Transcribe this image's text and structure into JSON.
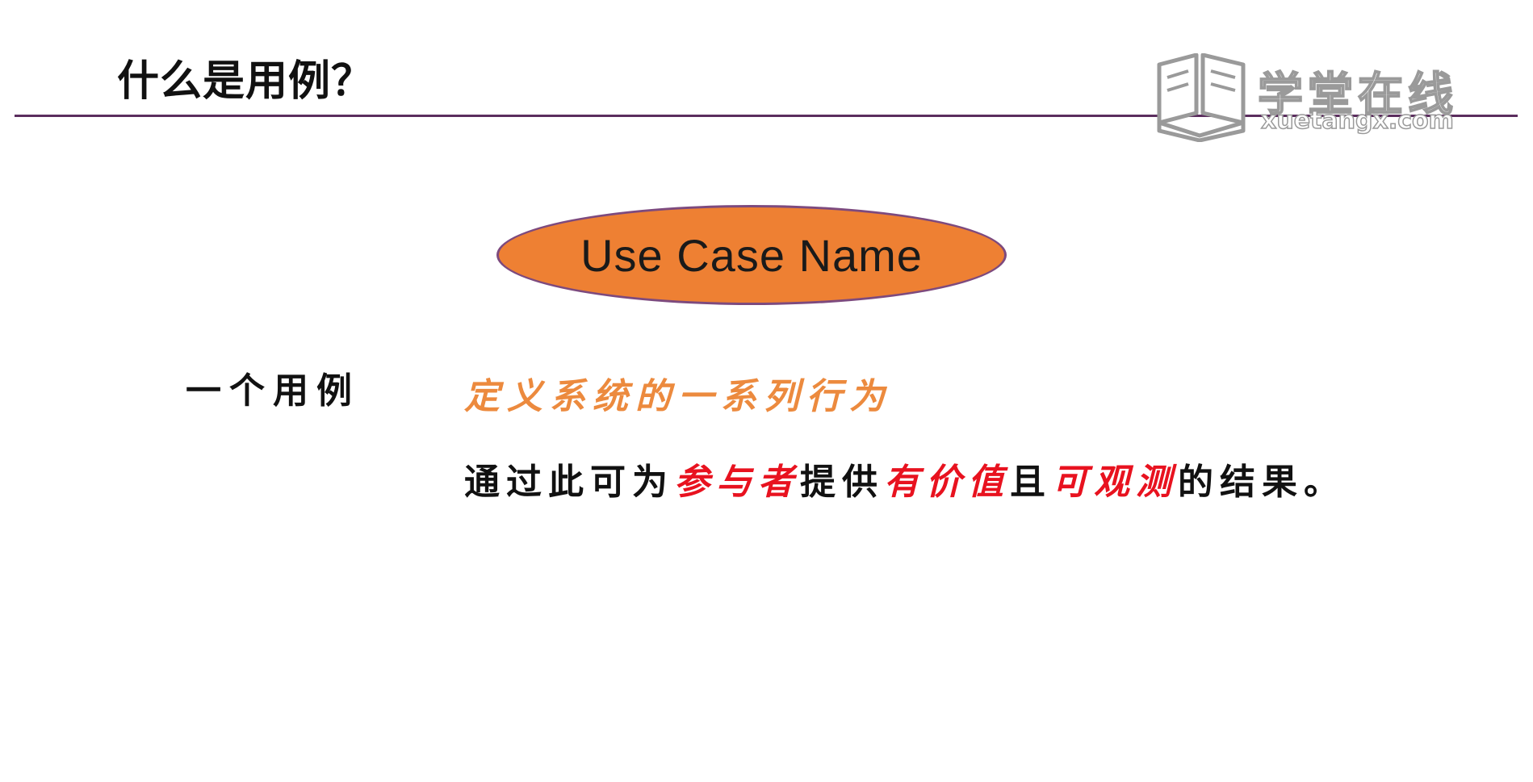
{
  "slide": {
    "title": "什么是用例？",
    "logo": {
      "name_cn": "学堂在线",
      "name_en": "xuetangx.com"
    },
    "usecase_shape": {
      "label": "Use Case Name",
      "fill_color": "#ee8033",
      "border_color": "#7d4a7e"
    },
    "definition": {
      "label": "一个用例",
      "line1": "定义系统的一系列行为",
      "line2": {
        "part1": "通过此可为",
        "highlight1": "参与者",
        "part2": "提供",
        "highlight2": "有价值",
        "part3": "且",
        "highlight3": "可观测",
        "part4": "的结果。"
      }
    },
    "colors": {
      "accent_orange": "#ec8a3e",
      "accent_red": "#e8121f",
      "rule": "#5b2d5e"
    }
  }
}
